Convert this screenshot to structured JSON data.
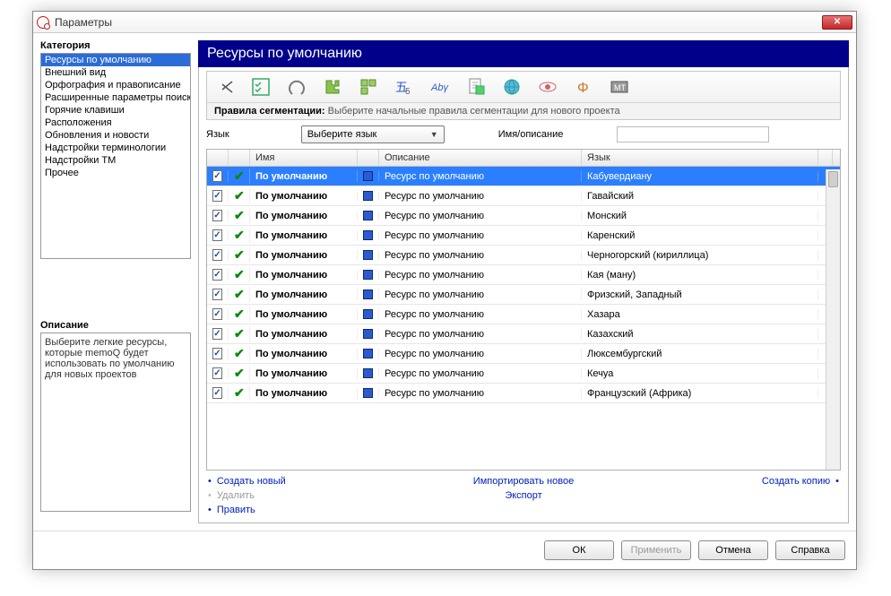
{
  "window": {
    "title": "Параметры"
  },
  "sidebar": {
    "category_label": "Категория",
    "items": [
      "Ресурсы по умолчанию",
      "Внешний вид",
      "Орфография и правописание",
      "Расширенные параметры поиска",
      "Горячие клавиши",
      "Расположения",
      "Обновления и новости",
      "Надстройки терминологии",
      "Надстройки TM",
      "Прочее"
    ],
    "selected_index": 0,
    "description_label": "Описание",
    "description_text": "Выберите легкие ресурсы, которые memoQ будет использовать по умолчанию для новых проектов"
  },
  "page_title": "Ресурсы по умолчанию",
  "toolbar": {
    "caption_label": "Правила сегментации:",
    "caption_text": "Выберите начальные правила сегментации для нового проекта",
    "icons": [
      "scissors-icon",
      "checklist-icon",
      "horseshoe-icon",
      "puzzle-icon",
      "puzzle-multi-icon",
      "asian-char-icon",
      "abc-icon",
      "document-icon",
      "globe-icon",
      "eye-icon",
      "phi-icon",
      "mt-icon"
    ]
  },
  "filters": {
    "lang_label": "Язык",
    "lang_select_text": "Выберите язык",
    "name_label": "Имя/описание"
  },
  "grid": {
    "headers": {
      "name": "Имя",
      "desc": "Описание",
      "lang": "Язык"
    },
    "rows": [
      {
        "name": "По умолчанию",
        "desc": "Ресурс по умолчанию",
        "lang": "Кабувердиану",
        "selected": true
      },
      {
        "name": "По умолчанию",
        "desc": "Ресурс по умолчанию",
        "lang": "Гавайский"
      },
      {
        "name": "По умолчанию",
        "desc": "Ресурс по умолчанию",
        "lang": "Монский"
      },
      {
        "name": "По умолчанию",
        "desc": "Ресурс по умолчанию",
        "lang": "Каренский"
      },
      {
        "name": "По умолчанию",
        "desc": "Ресурс по умолчанию",
        "lang": "Черногорский (кириллица)"
      },
      {
        "name": "По умолчанию",
        "desc": "Ресурс по умолчанию",
        "lang": "Кая (ману)"
      },
      {
        "name": "По умолчанию",
        "desc": "Ресурс по умолчанию",
        "lang": "Фризский, Западный"
      },
      {
        "name": "По умолчанию",
        "desc": "Ресурс по умолчанию",
        "lang": "Хазара"
      },
      {
        "name": "По умолчанию",
        "desc": "Ресурс по умолчанию",
        "lang": "Казахский"
      },
      {
        "name": "По умолчанию",
        "desc": "Ресурс по умолчанию",
        "lang": "Люксембургский"
      },
      {
        "name": "По умолчанию",
        "desc": "Ресурс по умолчанию",
        "lang": "Кечуа"
      },
      {
        "name": "По умолчанию",
        "desc": "Ресурс по умолчанию",
        "lang": "Французский (Африка)"
      }
    ]
  },
  "links": {
    "create": "Создать новый",
    "import": "Импортировать новое",
    "copy": "Создать копию",
    "delete": "Удалить",
    "export": "Экспорт",
    "edit": "Править"
  },
  "buttons": {
    "ok": "ОК",
    "apply": "Применить",
    "cancel": "Отмена",
    "help": "Справка"
  }
}
